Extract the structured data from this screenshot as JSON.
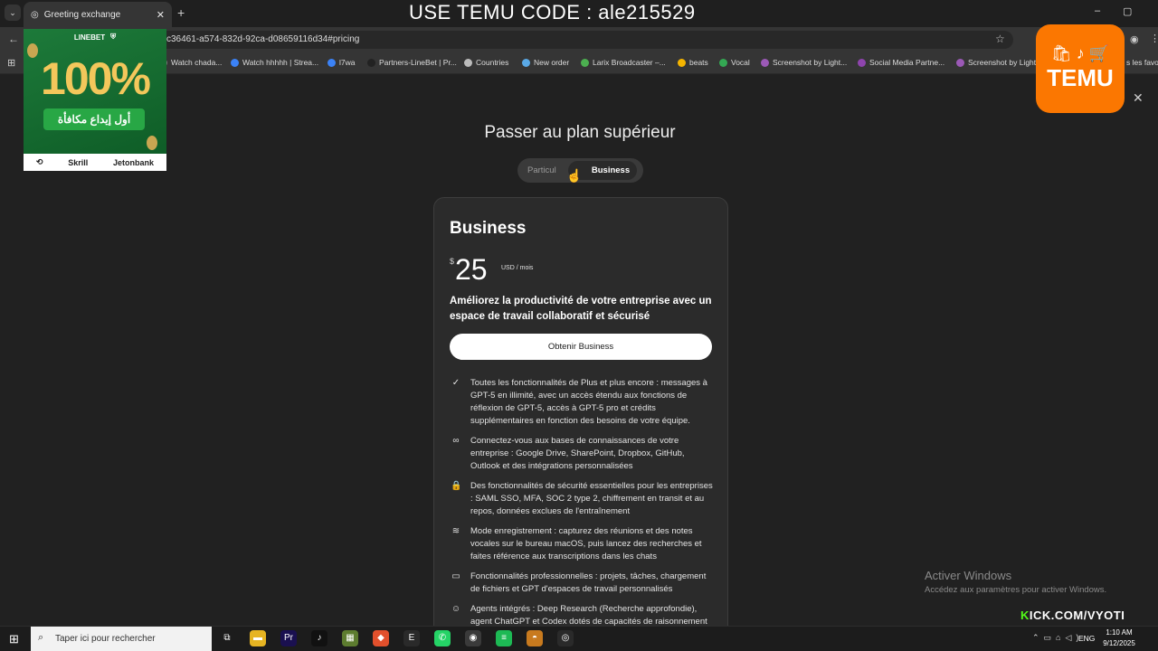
{
  "browser": {
    "tab_title": "Greeting exchange",
    "url": "c36461-a574-832d-92ca-d08659116d34#pricing",
    "bookmarks": [
      {
        "label": "Watch chada...",
        "color": "#777777"
      },
      {
        "label": "Watch hhhhh | Strea...",
        "color": "#3b82f6"
      },
      {
        "label": "l7wa",
        "color": "#3b82f6"
      },
      {
        "label": "Partners-LineBet | Pr...",
        "color": "#222222"
      },
      {
        "label": "Countries",
        "color": "#bbbbbb"
      },
      {
        "label": "New order",
        "color": "#5aa9e6"
      },
      {
        "label": "Larix Broadcaster –...",
        "color": "#4caf50"
      },
      {
        "label": "beats",
        "color": "#f4b400"
      },
      {
        "label": "Vocal",
        "color": "#34a853"
      },
      {
        "label": "Screenshot by Light...",
        "color": "#9b59b6"
      },
      {
        "label": "Social Media Partne...",
        "color": "#8e44ad"
      },
      {
        "label": "Screenshot by Light...",
        "color": "#9b59b6"
      },
      {
        "label": "s les favori",
        "color": "#353535"
      }
    ]
  },
  "overlay": {
    "title": "USE TEMU CODE : ale215529",
    "linebet_ad": {
      "brand": "LINEBET",
      "percent": "100%",
      "arabic": "أول إيداع مكافأة",
      "partners": [
        "Skrill",
        "Jetonbank"
      ]
    },
    "temu_ad": {
      "icons": "🛍 ♪ 🛒",
      "word": "TEMU"
    },
    "kick": {
      "prefix": "K",
      "rest": "ICK.COM/VYOTI"
    }
  },
  "page": {
    "heading": "Passer au plan supérieur",
    "toggle": {
      "personal": "Particul",
      "business": "Business"
    },
    "plan": {
      "name": "Business",
      "currency": "$",
      "price": "25",
      "unit": "USD / mois",
      "description": "Améliorez la productivité de votre entreprise avec un espace de travail collaboratif et sécurisé",
      "cta": "Obtenir Business"
    },
    "features": [
      {
        "icon": "✓",
        "name": "sparkle-check-icon",
        "text": "Toutes les fonctionnalités de Plus et plus encore : messages à GPT-5 en illimité, avec un accès étendu aux fonctions de réflexion de GPT-5, accès à GPT-5 pro et crédits supplémentaires en fonction des besoins de votre équipe."
      },
      {
        "icon": "∞",
        "name": "link-icon",
        "text": "Connectez-vous aux bases de connaissances de votre entreprise : Google Drive, SharePoint, Dropbox, GitHub, Outlook et des intégrations personnalisées"
      },
      {
        "icon": "🔒",
        "name": "lock-icon",
        "text": "Des fonctionnalités de sécurité essentielles pour les entreprises : SAML SSO, MFA, SOC 2 type 2, chiffrement en transit et au repos, données exclues de l'entraînement"
      },
      {
        "icon": "≋",
        "name": "waveform-icon",
        "text": "Mode enregistrement : capturez des réunions et des notes vocales sur le bureau macOS, puis lancez des recherches et faites référence aux transcriptions dans les chats"
      },
      {
        "icon": "▭",
        "name": "folder-icon",
        "text": "Fonctionnalités professionnelles : projets, tâches, chargement de fichiers et GPT d'espaces de travail personnalisés"
      },
      {
        "icon": "☺",
        "name": "agent-icon",
        "text": "Agents intégrés : Deep Research (Recherche approfondie), agent ChatGPT et Codex dotés de capacités de raisonnement"
      }
    ],
    "activate_windows": {
      "title": "Activer Windows",
      "subtitle": "Accédez aux paramètres pour activer Windows."
    }
  },
  "taskbar": {
    "search_placeholder": "Taper ici pour rechercher",
    "lang": "ENG",
    "time": "1:10 AM",
    "date": "9/12/2025",
    "apps": [
      {
        "name": "task-view-icon",
        "glyph": "⧉",
        "color": "#1c1c1c"
      },
      {
        "name": "file-explorer-icon",
        "glyph": "▬",
        "color": "#e6b422"
      },
      {
        "name": "premiere-icon",
        "glyph": "Pr",
        "color": "#1a1050"
      },
      {
        "name": "tiktok-icon",
        "glyph": "♪",
        "color": "#111111"
      },
      {
        "name": "minecraft-icon",
        "glyph": "▦",
        "color": "#5d7c2f"
      },
      {
        "name": "brave-icon",
        "glyph": "◆",
        "color": "#e2502c"
      },
      {
        "name": "epic-games-icon",
        "glyph": "E",
        "color": "#2a2a2a"
      },
      {
        "name": "whatsapp-icon",
        "glyph": "✆",
        "color": "#25d366"
      },
      {
        "name": "chrome-icon",
        "glyph": "◉",
        "color": "#3a3a3a"
      },
      {
        "name": "spotify-icon",
        "glyph": "≡",
        "color": "#1db954"
      },
      {
        "name": "app-icon",
        "glyph": "◓",
        "color": "#c87a1e"
      },
      {
        "name": "obs-icon",
        "glyph": "◎",
        "color": "#2a2a2a"
      }
    ]
  }
}
